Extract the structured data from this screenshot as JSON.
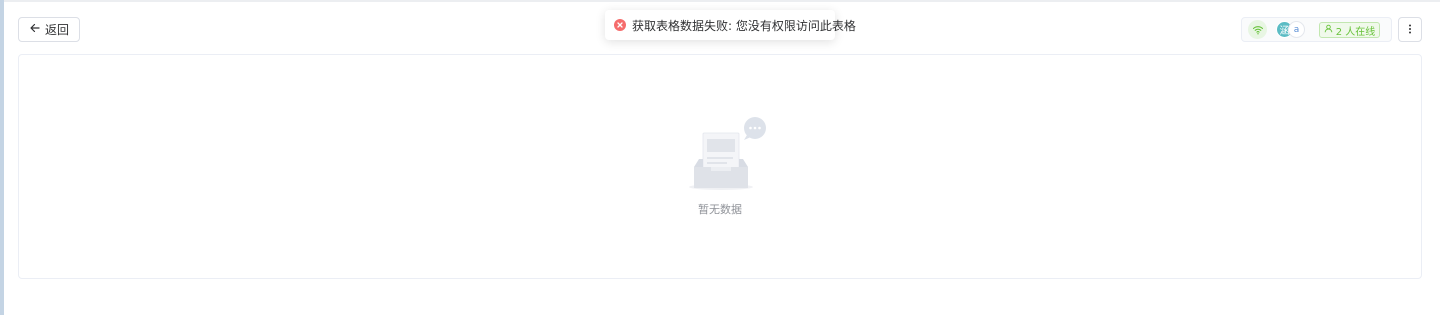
{
  "toolbar": {
    "back_label": "返回",
    "back_icon": "arrow-left-icon",
    "more_icon": "more-vertical-icon"
  },
  "toast": {
    "type": "error",
    "message": "获取表格数据失败: 您没有权限访问此表格",
    "icon": "error-circle-icon",
    "color": "#f56c6c"
  },
  "status": {
    "connection_icon": "wifi-icon",
    "connection_color": "#67c23a",
    "avatars": [
      {
        "initial": "涵",
        "color": "#5bbcc4"
      },
      {
        "initial": "a",
        "color": "#5b8fd6"
      }
    ],
    "online_label": "2 人在线",
    "online_icon": "user-icon"
  },
  "table": {
    "empty_text": "暂无数据",
    "empty_icon": "empty-box-icon"
  }
}
